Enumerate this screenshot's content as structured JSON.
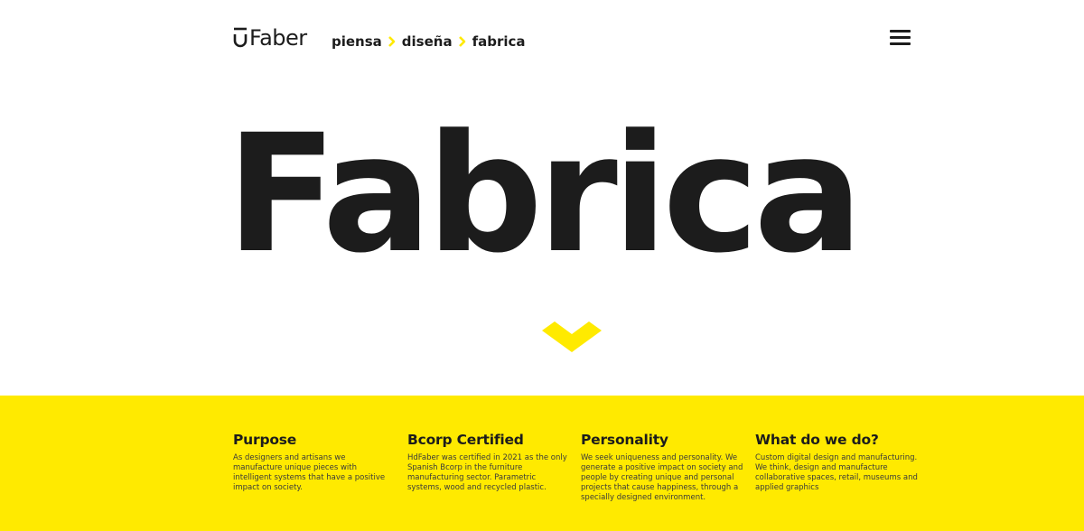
{
  "header": {
    "logo_text": "Faber",
    "breadcrumb": [
      "piensa",
      "diseña",
      "fabrica"
    ],
    "menu_icon": "hamburger-icon"
  },
  "hero": {
    "title": "Fabrica",
    "scroll_icon": "chevron-down-icon"
  },
  "colors": {
    "accent": "#ffea00",
    "text": "#1c1c1c",
    "background": "#ffffff"
  },
  "features": [
    {
      "title": "Purpose",
      "text": "As designers and artisans we manufacture unique pieces with intelligent systems that have a positive impact on society."
    },
    {
      "title": "Bcorp Certified",
      "text": "HdFaber was certified in 2021 as the only Spanish Bcorp in the furniture manufacturing sector. Parametric systems, wood and recycled plastic."
    },
    {
      "title": "Personality",
      "text": "We seek uniqueness and personality. We generate a positive impact on society and people by creating unique and personal projects that cause happiness, through a specially designed environment."
    },
    {
      "title": "What do we do?",
      "text": "Custom digital design and manufacturing. We think, design and manufacture collaborative spaces, retail, museums and applied graphics"
    }
  ]
}
